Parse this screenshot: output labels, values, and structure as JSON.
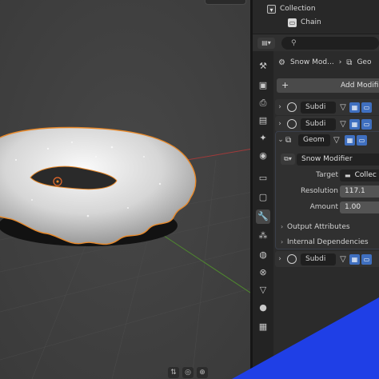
{
  "outliner": {
    "items": [
      {
        "label": "Collection",
        "icon": "collection-icon",
        "color": "#e6e6e6"
      },
      {
        "label": "Chain",
        "icon": "object-icon",
        "color": "#e6e6e6"
      }
    ]
  },
  "header": {
    "editor_icon": "properties-editor-icon",
    "search_placeholder": "",
    "search_icon": "search-icon"
  },
  "breadcrumb": {
    "object_label": "Snow Mod...",
    "separator": "›",
    "modifier_label": "Geo"
  },
  "add_modifier": {
    "label": "Add Modifie"
  },
  "tabs": [
    {
      "name": "tool-icon",
      "glyph": "⚒"
    },
    {
      "name": "render-icon",
      "glyph": "▣"
    },
    {
      "name": "output-icon",
      "glyph": "⎙"
    },
    {
      "name": "view-layer-icon",
      "glyph": "▤"
    },
    {
      "name": "scene-icon",
      "glyph": "✦"
    },
    {
      "name": "world-icon",
      "glyph": "◉"
    },
    {
      "name": "collection-tab-icon",
      "glyph": "▭"
    },
    {
      "name": "object-tab-icon",
      "glyph": "▢"
    },
    {
      "name": "modifier-icon",
      "glyph": "🔧"
    },
    {
      "name": "particles-icon",
      "glyph": "⁂"
    },
    {
      "name": "physics-icon",
      "glyph": "◍"
    },
    {
      "name": "constraints-icon",
      "glyph": "⊗"
    },
    {
      "name": "data-icon",
      "glyph": "▽"
    },
    {
      "name": "material-icon",
      "glyph": "●"
    },
    {
      "name": "texture-icon",
      "glyph": "▦"
    }
  ],
  "modifiers": [
    {
      "name": "Subdi"
    },
    {
      "name": "Subdi"
    },
    {
      "name": "Subdi"
    }
  ],
  "geo_nodes": {
    "name": "Geom",
    "node_group": "Snow Modifier",
    "target_label": "Target",
    "target_value": "Collec",
    "resolution_label": "Resolution",
    "resolution_value": "117.1",
    "amount_label": "Amount",
    "amount_value": "1.00",
    "output_attributes_label": "Output Attributes",
    "internal_dependencies_label": "Internal Dependencies"
  },
  "colors": {
    "accent_blue": "#3f6fbf",
    "selection_orange": "#e8892a",
    "shape_blue": "#1f3fe6"
  }
}
